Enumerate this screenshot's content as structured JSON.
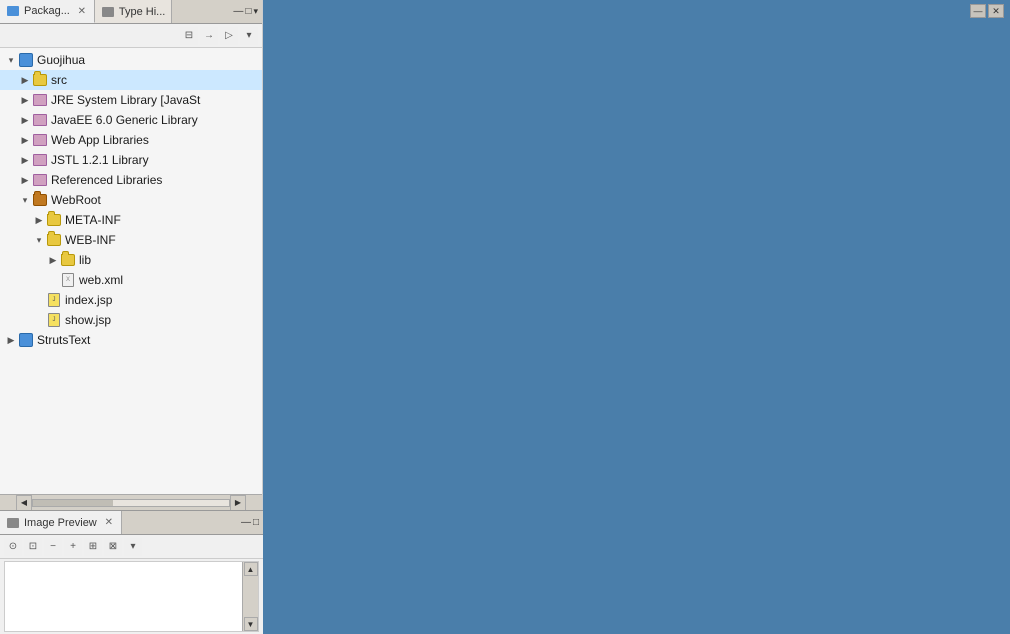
{
  "tabs": [
    {
      "id": "package-explorer",
      "label": "Packag...",
      "active": true
    },
    {
      "id": "type-hierarchy",
      "label": "Type Hi...",
      "active": false
    }
  ],
  "toolbar": {
    "buttons": [
      "⊟",
      "→",
      "▷",
      "▾"
    ]
  },
  "tree": {
    "items": [
      {
        "id": "guojihua",
        "label": "Guojihua",
        "indent": 0,
        "arrow": "expanded",
        "icon": "project",
        "level": 0
      },
      {
        "id": "src",
        "label": "src",
        "indent": 1,
        "arrow": "collapsed",
        "icon": "src-folder",
        "level": 1,
        "selected": true
      },
      {
        "id": "jre-system",
        "label": "JRE System Library [JavaSt",
        "indent": 1,
        "arrow": "collapsed",
        "icon": "library",
        "level": 1
      },
      {
        "id": "javaee",
        "label": "JavaEE 6.0 Generic Library",
        "indent": 1,
        "arrow": "collapsed",
        "icon": "library",
        "level": 1
      },
      {
        "id": "webapp-libs",
        "label": "Web App Libraries",
        "indent": 1,
        "arrow": "collapsed",
        "icon": "library",
        "level": 1
      },
      {
        "id": "jstl",
        "label": "JSTL 1.2.1 Library",
        "indent": 1,
        "arrow": "collapsed",
        "icon": "library",
        "level": 1
      },
      {
        "id": "ref-libs",
        "label": "Referenced Libraries",
        "indent": 1,
        "arrow": "collapsed",
        "icon": "library",
        "level": 1
      },
      {
        "id": "webroot",
        "label": "WebRoot",
        "indent": 1,
        "arrow": "expanded",
        "icon": "webroot-folder",
        "level": 1
      },
      {
        "id": "meta-inf",
        "label": "META-INF",
        "indent": 2,
        "arrow": "collapsed",
        "icon": "folder",
        "level": 2
      },
      {
        "id": "web-inf",
        "label": "WEB-INF",
        "indent": 2,
        "arrow": "expanded",
        "icon": "folder",
        "level": 2
      },
      {
        "id": "lib",
        "label": "lib",
        "indent": 3,
        "arrow": "collapsed",
        "icon": "folder",
        "level": 3
      },
      {
        "id": "web-xml",
        "label": "web.xml",
        "indent": 3,
        "arrow": "none",
        "icon": "xml-file",
        "level": 3
      },
      {
        "id": "index-jsp",
        "label": "index.jsp",
        "indent": 2,
        "arrow": "none",
        "icon": "jsp-file",
        "level": 2
      },
      {
        "id": "show-jsp",
        "label": "show.jsp",
        "indent": 2,
        "arrow": "none",
        "icon": "jsp-file",
        "level": 2
      },
      {
        "id": "strutstext",
        "label": "StrutsText",
        "indent": 0,
        "arrow": "collapsed",
        "icon": "project",
        "level": 0
      }
    ]
  },
  "bottom_panel": {
    "tab_label": "Image Preview",
    "toolbar_buttons": [
      "⊙",
      "⊡",
      "−",
      "+",
      "⊞",
      "⊠",
      "▾"
    ]
  },
  "window": {
    "minimize": "—",
    "maximize": "□",
    "close": "✕"
  }
}
